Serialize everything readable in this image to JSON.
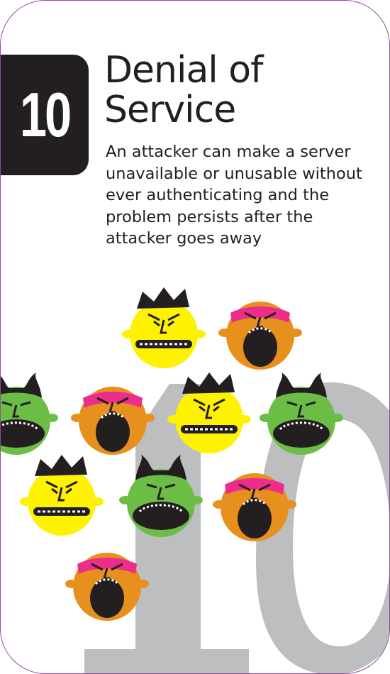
{
  "card": {
    "number": "10",
    "title": "Denial of\nService",
    "description": "An attacker can make a server unavailable or unusable without ever authenticating and the problem persists after the attacker goes away",
    "watermark_number": "10"
  },
  "colors": {
    "border": "#8e4a9c",
    "badge_bg": "#231f20",
    "watermark": "#bcbec0",
    "yellow_face": "#fff200",
    "orange_face": "#e8901e",
    "green_face": "#6cbd45",
    "pink_mask": "#ec2d8c",
    "dark": "#231f20"
  },
  "faces": [
    {
      "type": "crown-yellow"
    },
    {
      "type": "pirate-orange"
    },
    {
      "type": "horned-green"
    },
    {
      "type": "pirate-orange"
    },
    {
      "type": "crown-yellow"
    },
    {
      "type": "horned-green"
    },
    {
      "type": "crown-yellow"
    },
    {
      "type": "horned-green"
    },
    {
      "type": "pirate-orange"
    },
    {
      "type": "pirate-orange"
    }
  ]
}
